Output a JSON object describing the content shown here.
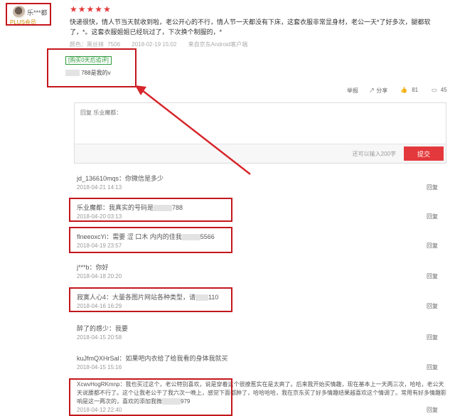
{
  "review": {
    "username": "乐***都",
    "member_level": "PLUS会员",
    "stars": [
      "★",
      "★",
      "★",
      "★",
      "★"
    ],
    "text": "快递很快，情人节当天就收到啦，老公开心的不行，情人节一天都没有下床，这套衣服非常显身材，老公一天*了好多次，腿都软了，*。这套衣服姐姐已经玩过了，下次换个制服的，*",
    "color_label": "颜色：黑丝袜",
    "color_value": "7506",
    "date": "2018-02-19 15:02",
    "source": "来自京东Android客户端",
    "follow_tag": "[购买0天后追评]",
    "follow_text": "788是我的v"
  },
  "actions": {
    "report": "举报",
    "share": "分享",
    "like_count": "81",
    "comment_count": "45"
  },
  "reply_box": {
    "placeholder": "回复 乐业魔都：",
    "char_limit": "还可以输入200字",
    "submit": "提交"
  },
  "comments": [
    {
      "user": "jd_136610mqs：你微信是多少",
      "date": "2018-04-21 14:13",
      "reply": "回复"
    },
    {
      "user": "乐业魔都：我真实的号码是",
      "tail": "788",
      "date": "2018-04-20 03:13",
      "reply": "回复"
    },
    {
      "user": "flneeoxcYi：需要 涩 口木 内内的佳我",
      "tail": "5566",
      "date": "2018-04-19 23:57",
      "reply": "回复"
    },
    {
      "user": "j***b：你好",
      "date": "2018-04-18 20:20",
      "reply": "回复"
    },
    {
      "user": "寂寞人心4：大量各图片网站各种类型，请",
      "tail": "110",
      "date": "2018-04-16 16:29",
      "reply": "回复"
    },
    {
      "user": "醉了的感少：我要",
      "date": "2018-04-15 20:58",
      "reply": "回复"
    },
    {
      "user": "kuJfmQXHrSal：如果吧内衣给了给我看的身体我就买",
      "date": "2018-04-15 15:16",
      "reply": "回复"
    },
    {
      "user": "XcwvHogRKmnp：我也买过这个，老公特别喜欢，说是穿着这个很撩惹实在是太爽了。后来我开始买情趣，现在基本上一天两三次，哈哈，老公天天说腰都不行了。这个让我老公干了我六次一晚上，感觉下面都肿了，哈哈哈哈，我在京东买了好多情趣结果越喜欢这个情调了。常用有好多情趣影响是这一两次的，喜欢的添加我微",
      "tail": "979",
      "date": "2018-04-12 22:40",
      "reply": "回复"
    }
  ]
}
